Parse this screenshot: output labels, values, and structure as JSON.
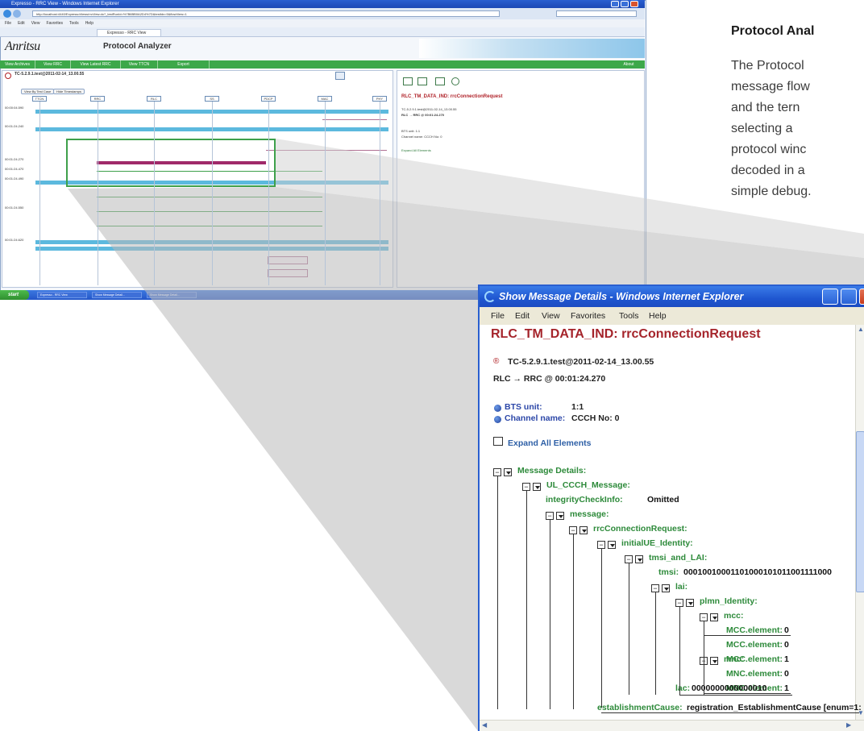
{
  "background_window": {
    "title": "Expresso - RRC View - Windows Internet Explorer",
    "address": "http://localhost:4440/ExpressoViews/rrcView.do?_testRunId=%7B6BB0A2D4%7D&testIdx=5&flowView=1",
    "menu": [
      "File",
      "Edit",
      "View",
      "Favorites",
      "Tools",
      "Help"
    ],
    "tab": "Expresso - RRC View",
    "logo": "Anritsu",
    "app_title": "Protocol Analyzer",
    "nav_tabs": [
      "View Archives",
      "View RRC",
      "View Latest RRC",
      "View TTCN",
      "Export"
    ],
    "nav_about": "About",
    "testcase": "TC-5.2.9.1.test@2011-02-14_13.00.55",
    "buttons": [
      "View By Test Case",
      "Hide Timestamps"
    ],
    "columns": [
      "TTCN",
      "RRC",
      "RLC",
      "SS",
      "PDCP",
      "MAC",
      "PHY"
    ],
    "timestamps": [
      "00:00:04.590",
      "00:01:24.240",
      "00:01:24.270",
      "00:01:24.470",
      "00:01:24.490",
      "00:01:24.550",
      "00:01:24.620"
    ],
    "right_title": "RLC_TM_DATA_IND: rrcConnectionRequest",
    "right_sub1": "TC-5.2.9.1.test@2011-02-14_13.00.55",
    "right_sub2": "RLC → RRC @ 00:01:24.270",
    "right_bts": "BTS unit:   1:1",
    "right_channel": "Channel name:  CCCH  No: 0",
    "right_expand": "Expand All Elements",
    "taskbar_start": "start",
    "taskbar_items": [
      "Expresso - RRC View",
      "Show Message Detail...",
      "Show Message Detail..."
    ]
  },
  "description": {
    "heading": "Protocol Anal",
    "lines": [
      "The Protocol",
      "message flow",
      "and the tern",
      "selecting a",
      "protocol winc",
      "decoded in a",
      "simple debug."
    ]
  },
  "detail_window": {
    "title": "Show Message Details - Windows Internet Explorer",
    "menu": [
      "File",
      "Edit",
      "View",
      "Favorites",
      "Tools",
      "Help"
    ],
    "heading": "RLC_TM_DATA_IND: rrcConnectionRequest",
    "testcase": "TC-5.2.9.1.test@2011-02-14_13.00.55",
    "route": "RLC → RRC @ 00:01:24.270",
    "bts_label": "BTS unit:",
    "bts_value": "1:1",
    "channel_label": "Channel name:",
    "channel_value": "CCCH  No: 0",
    "expand_all": "Expand All Elements",
    "tree": {
      "message_details": "Message Details:",
      "ul_ccch": "UL_CCCH_Message:",
      "integrity_key": "integrityCheckInfo:",
      "integrity_val": "Omitted",
      "message": "message:",
      "rrc_req": "rrcConnectionRequest:",
      "initial_ue": "initialUE_Identity:",
      "tmsi_lai": "tmsi_and_LAI:",
      "tmsi_key": "tmsi:",
      "tmsi_val": "00010010001101000101011001111000",
      "lai": "lai:",
      "plmn": "plmn_Identity:",
      "mcc": "mcc:",
      "mcc_elements": [
        {
          "key": "MCC.element:",
          "val": "0"
        },
        {
          "key": "MCC.element:",
          "val": "0"
        },
        {
          "key": "MCC.element:",
          "val": "1"
        }
      ],
      "mnc": "mnc:",
      "mnc_elements": [
        {
          "key": "MNC.element:",
          "val": "0"
        },
        {
          "key": "MNC.element:",
          "val": "1"
        }
      ],
      "lac_key": "lac:",
      "lac_val": "0000000000000010",
      "est_key": "establishmentCause:",
      "est_val": "registration_EstablishmentCause [enum=1:"
    }
  },
  "colors": {
    "accent_green": "#3da84a",
    "title_red": "#a5242b",
    "xp_blue": "#1f56d0",
    "tree_green": "#2d8a3a"
  }
}
